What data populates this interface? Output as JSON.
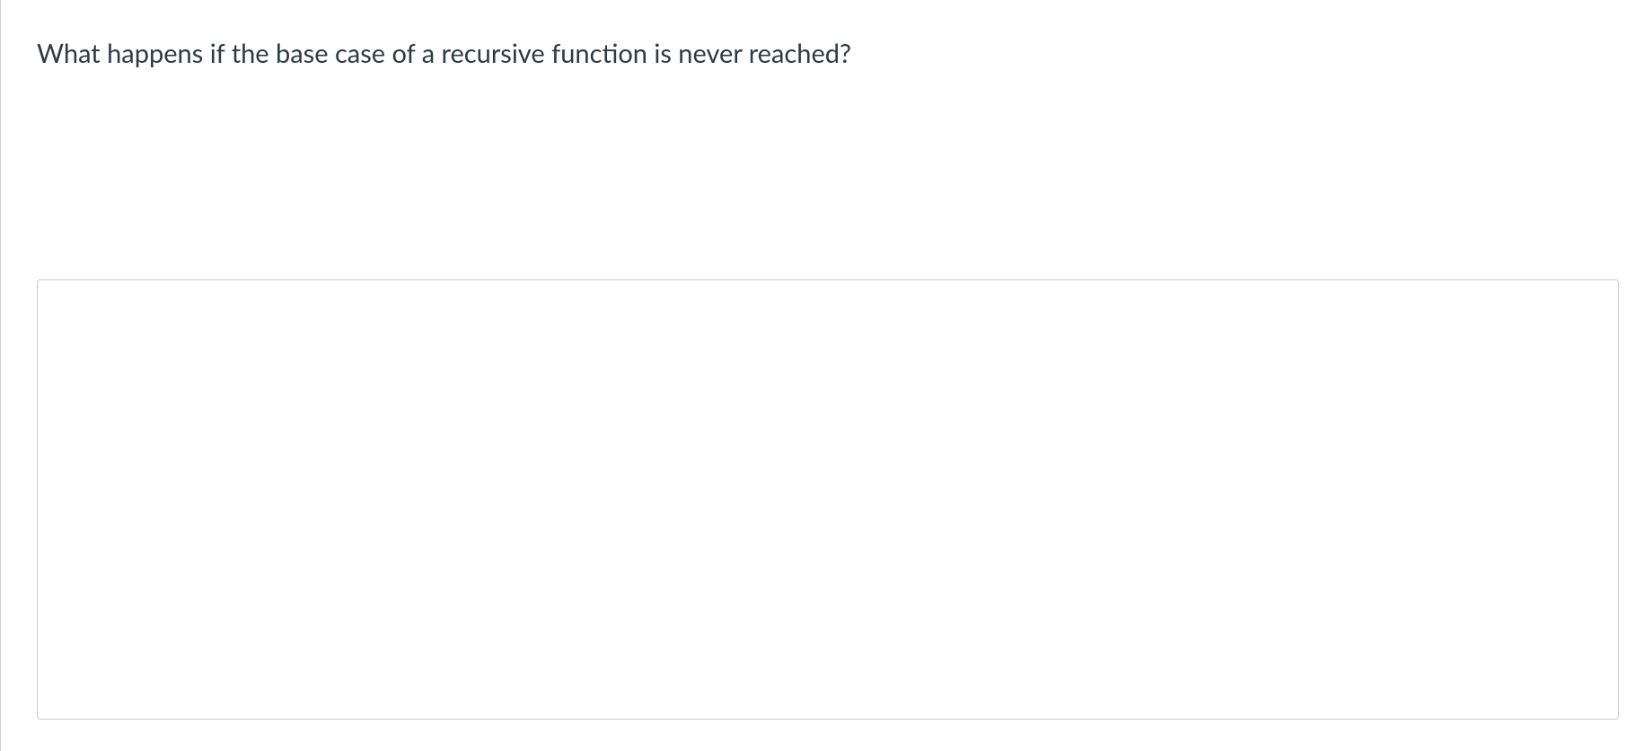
{
  "question": {
    "text": "What happens if the base case of a recursive function is never reached?",
    "answer_value": ""
  }
}
